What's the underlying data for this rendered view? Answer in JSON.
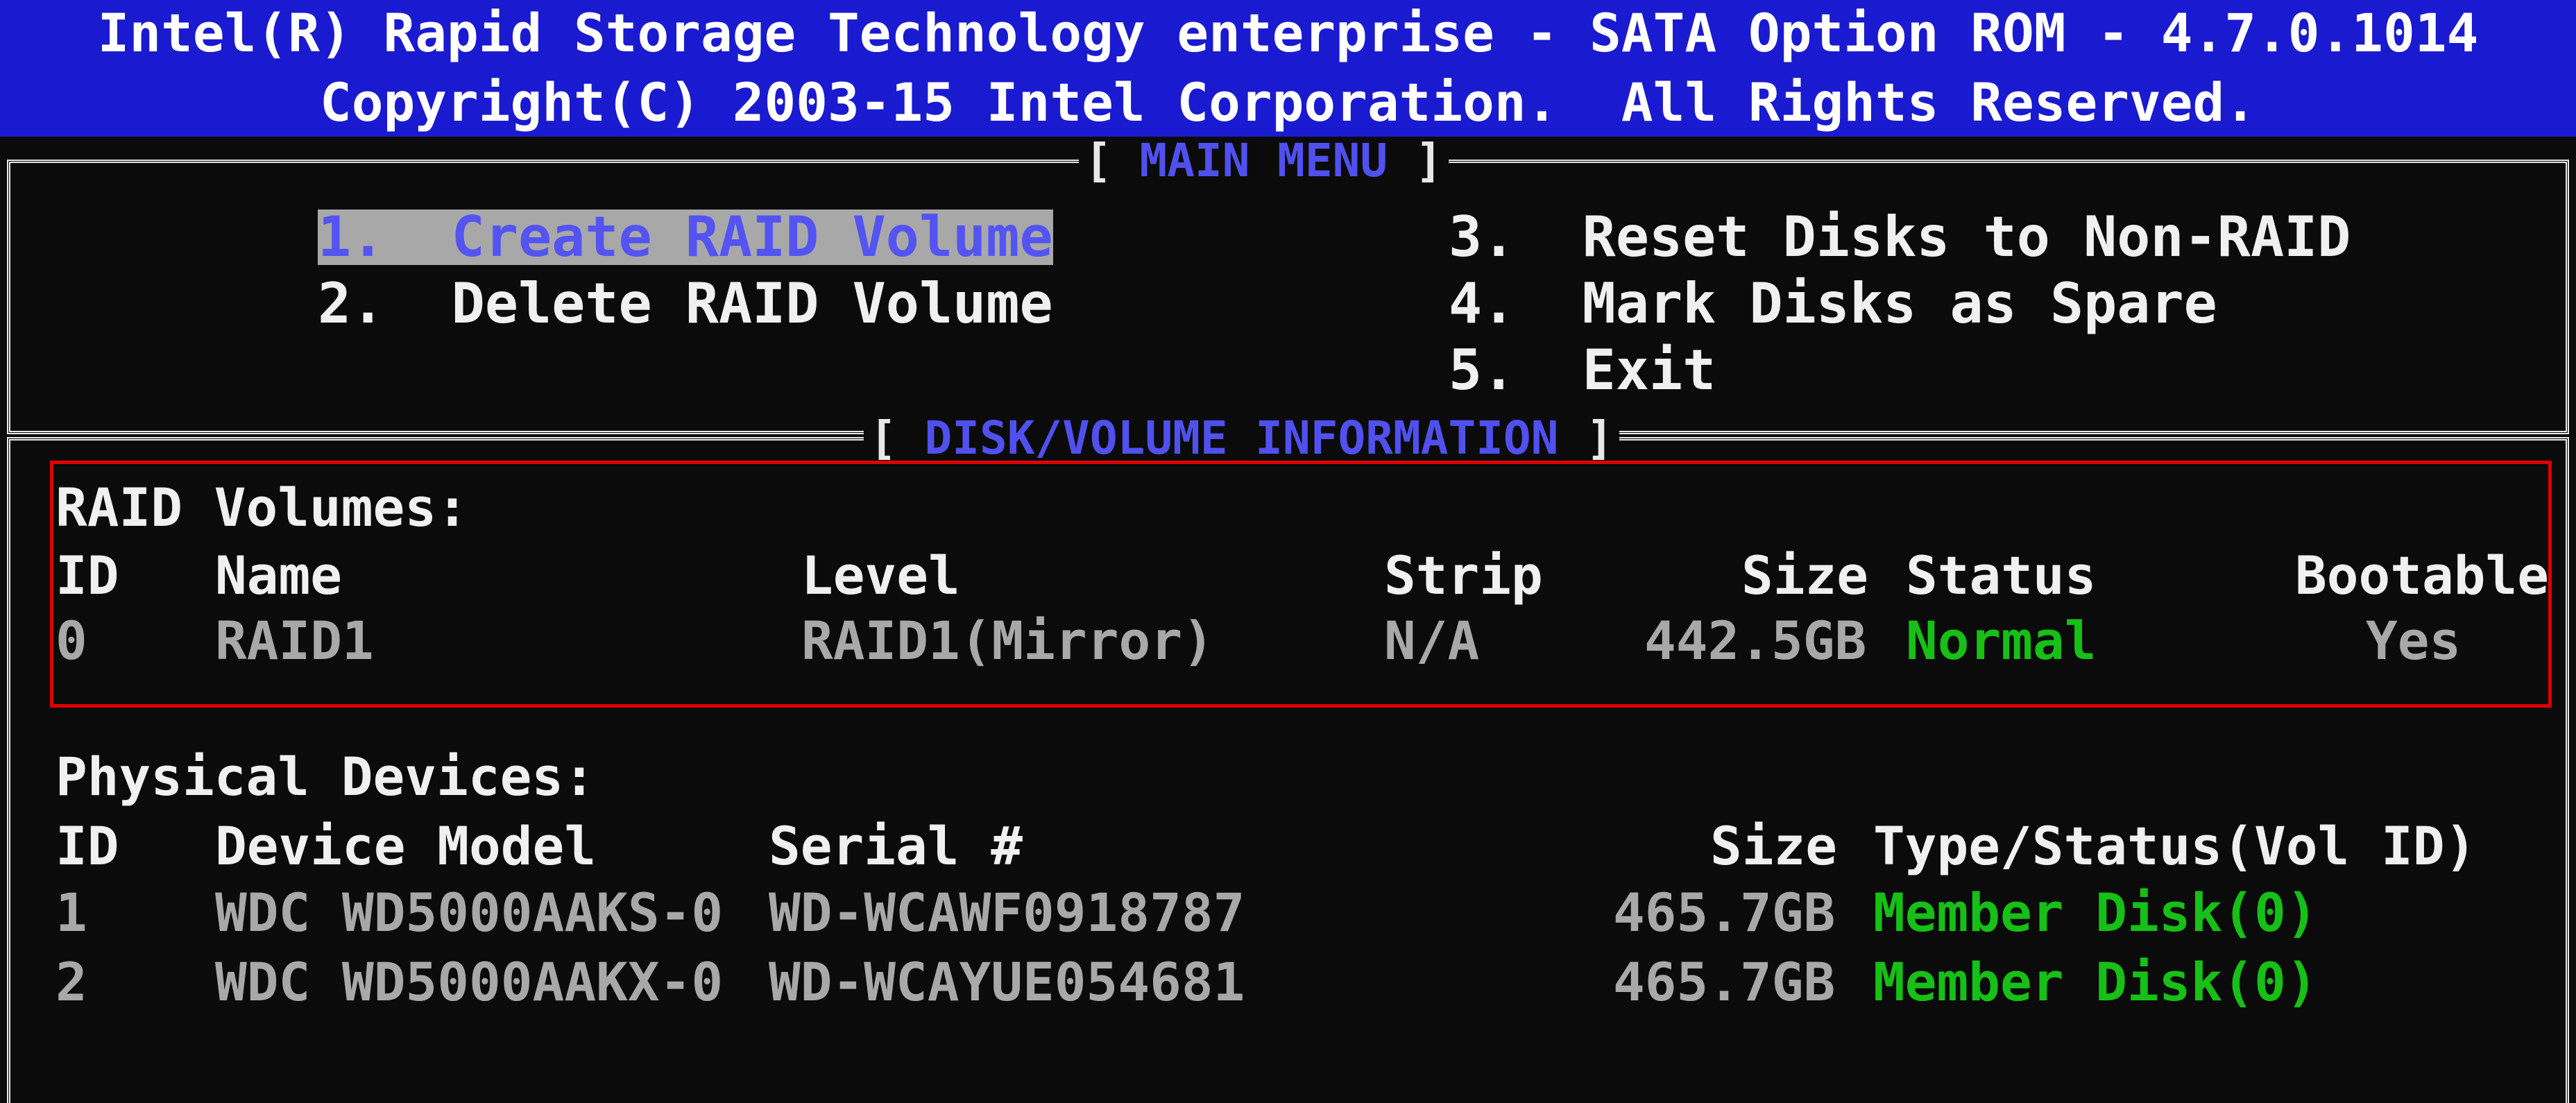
{
  "header": {
    "title": "Intel(R) Rapid Storage Technology enterprise - SATA Option ROM - 4.7.0.1014",
    "copyright": "Copyright(C) 2003-15 Intel Corporation.  All Rights Reserved."
  },
  "main_menu": {
    "title": "MAIN MENU",
    "items": [
      {
        "num": "1.",
        "label": "Create RAID Volume",
        "selected": true
      },
      {
        "num": "2.",
        "label": "Delete RAID Volume"
      },
      {
        "num": "3.",
        "label": "Reset Disks to Non-RAID"
      },
      {
        "num": "4.",
        "label": "Mark Disks as Spare"
      },
      {
        "num": "5.",
        "label": "Exit"
      }
    ]
  },
  "disk_info": {
    "title": "DISK/VOLUME INFORMATION",
    "raid_volumes": {
      "heading": "RAID Volumes:",
      "columns": {
        "id": "ID",
        "name": "Name",
        "level": "Level",
        "strip": "Strip",
        "size": "Size",
        "status": "Status",
        "bootable": "Bootable"
      },
      "rows": [
        {
          "id": "0",
          "name": "RAID1",
          "level": "RAID1(Mirror)",
          "strip": "N/A",
          "size": "442.5GB",
          "status": "Normal",
          "bootable": "Yes"
        }
      ]
    },
    "physical_devices": {
      "heading": "Physical Devices:",
      "columns": {
        "id": "ID",
        "model": "Device Model",
        "serial": "Serial #",
        "size": "Size",
        "type_status": "Type/Status(Vol ID)"
      },
      "rows": [
        {
          "id": "1",
          "model": "WDC WD5000AAKS-0",
          "serial": "WD-WCAWF0918787",
          "size": "465.7GB",
          "type_status": "Member Disk(0)"
        },
        {
          "id": "2",
          "model": "WDC WD5000AAKX-0",
          "serial": "WD-WCAYUE054681",
          "size": "465.7GB",
          "type_status": "Member Disk(0)"
        }
      ]
    }
  },
  "colors": {
    "header_bg": "#1a1ad0",
    "section_title": "#5050ee",
    "status_ok": "#16c016",
    "highlight_box": "#e00000"
  }
}
